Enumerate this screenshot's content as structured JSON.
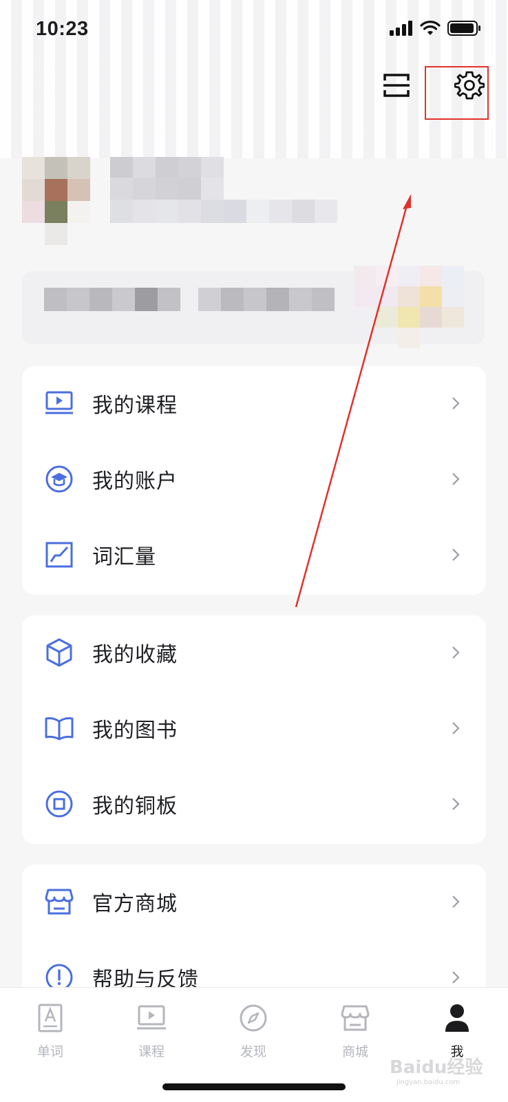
{
  "status_bar": {
    "time": "10:23"
  },
  "menu_groups": [
    {
      "items": [
        {
          "label": "我的课程",
          "icon": "laptop-play-icon"
        },
        {
          "label": "我的账户",
          "icon": "graduation-cap-icon"
        },
        {
          "label": "词汇量",
          "icon": "chart-line-icon"
        }
      ]
    },
    {
      "items": [
        {
          "label": "我的收藏",
          "icon": "cube-icon"
        },
        {
          "label": "我的图书",
          "icon": "open-book-icon"
        },
        {
          "label": "我的铜板",
          "icon": "coin-icon"
        }
      ]
    },
    {
      "items": [
        {
          "label": "官方商城",
          "icon": "store-icon"
        },
        {
          "label": "帮助与反馈",
          "icon": "exclamation-circle-icon"
        }
      ]
    }
  ],
  "tab_bar": {
    "tabs": [
      {
        "label": "单词",
        "icon": "word-card-icon",
        "active": false
      },
      {
        "label": "课程",
        "icon": "course-icon",
        "active": false
      },
      {
        "label": "发现",
        "icon": "compass-icon",
        "active": false
      },
      {
        "label": "商城",
        "icon": "store-icon",
        "active": false
      },
      {
        "label": "我",
        "icon": "person-icon",
        "active": true
      }
    ]
  },
  "watermark": {
    "brand": "Baidu经验",
    "url": "jingyan.baidu.com"
  },
  "colors": {
    "accent": "#4a6ee0",
    "highlight": "#e0312b",
    "background": "#f6f6f7"
  }
}
